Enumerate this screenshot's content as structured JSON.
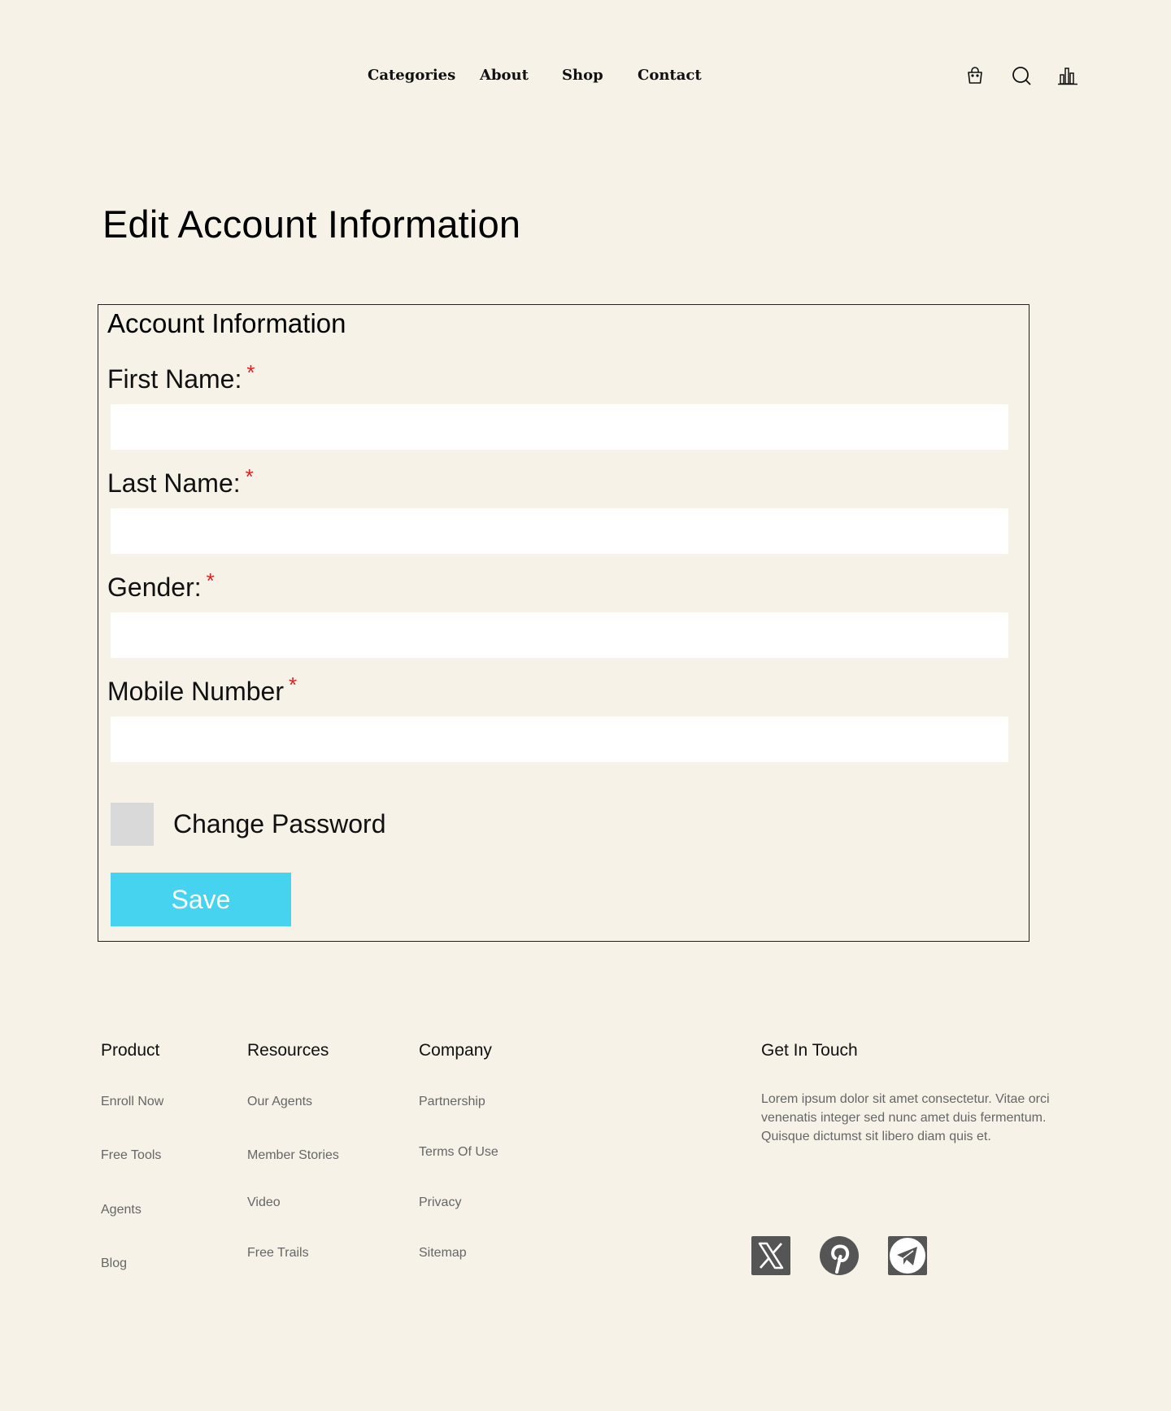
{
  "header": {
    "nav": [
      {
        "label": "Categories"
      },
      {
        "label": "About"
      },
      {
        "label": "Shop"
      },
      {
        "label": "Contact"
      }
    ],
    "icons": [
      "shopping-bag-icon",
      "search-icon",
      "chart-icon"
    ]
  },
  "page": {
    "title": "Edit Account Information"
  },
  "form": {
    "section_title": "Account Information",
    "required_marker": "*",
    "fields": [
      {
        "label": "First Name:",
        "value": ""
      },
      {
        "label": "Last Name:",
        "value": ""
      },
      {
        "label": "Gender:",
        "value": ""
      },
      {
        "label": "Mobile Number",
        "value": ""
      }
    ],
    "change_password": {
      "label": "Change Password",
      "checked": false
    },
    "save_label": "Save"
  },
  "footer": {
    "columns": [
      {
        "heading": "Product",
        "links": [
          "Enroll Now",
          "Free Tools",
          "Agents",
          "Blog"
        ]
      },
      {
        "heading": "Resources",
        "links": [
          "Our Agents",
          "Member Stories",
          "Video",
          "Free Trails"
        ]
      },
      {
        "heading": "Company",
        "links": [
          "Partnership",
          "Terms Of Use",
          "Privacy",
          "Sitemap"
        ]
      }
    ],
    "contact": {
      "heading": "Get In Touch",
      "text": "Lorem ipsum dolor sit amet consectetur. Vitae orci venenatis integer sed nunc amet duis fermentum. Quisque dictumst sit libero diam quis et."
    },
    "social": [
      "x-icon",
      "pinterest-icon",
      "telegram-icon"
    ]
  },
  "colors": {
    "background": "#f6f2e8",
    "accent": "#45d3f0",
    "required": "#e02020",
    "checkbox": "#d9d9d9",
    "social_icon": "#555555"
  }
}
